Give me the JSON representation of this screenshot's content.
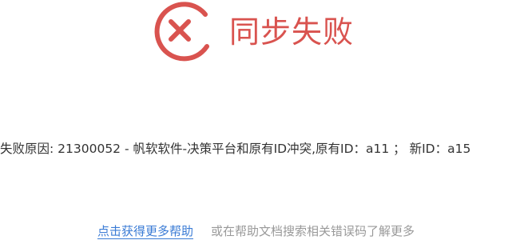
{
  "status": {
    "icon": "close-circle-icon",
    "title": "同步失败",
    "color": "#d9534f"
  },
  "reason": {
    "text": "失败原因: 21300052 - 帆软软件-决策平台和原有ID冲突,原有ID：a11 ； 新ID：a15"
  },
  "help": {
    "link_label": "点击获得更多帮助",
    "hint": "或在帮助文档搜索相关错误码了解更多",
    "link_color": "#3a7bd5",
    "hint_color": "#999999"
  }
}
